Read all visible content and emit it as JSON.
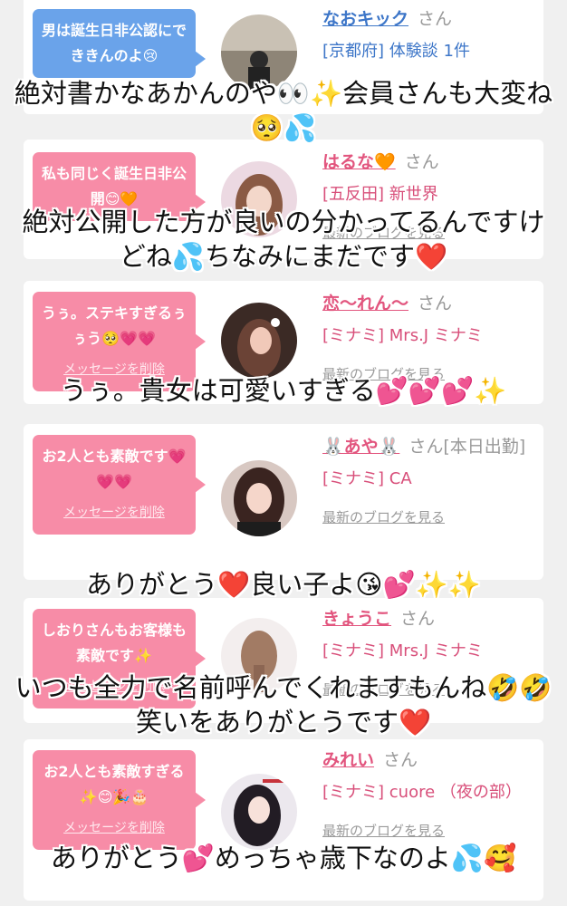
{
  "cards": [
    {
      "message": "男は誕生日非公認にでききんのよ😢",
      "bubble_color": "#6aa3ea",
      "name": "なおキック",
      "suffix": "さん",
      "shop": "[京都府] 体験談 1件",
      "theme": "blue",
      "caption": "絶対書かなあかんのや👀✨会員さんも大変ね🥺💦"
    },
    {
      "message": "私も同じく誕生日非公開😊🧡",
      "bubble_color": "#f78ca7",
      "name": "はるな🧡",
      "suffix": "さん",
      "shop": "[五反田] 新世界",
      "blog": "最新のブログを見る",
      "caption": "絶対公開した方が良いの分かってるんですけどね💦ちなみにまだです❤️"
    },
    {
      "message": "うぅ。ステキすぎるぅぅう🥺💗💗",
      "delete_label": "メッセージを削除",
      "name": "恋～れん～",
      "suffix": "さん",
      "shop": "[ミナミ] Mrs.J ミナミ",
      "blog": "最新のブログを見る",
      "caption": "うぅ。貴女は可愛いすぎる💕💕💕✨"
    },
    {
      "message": "お2人とも素敵です💗💗💗",
      "delete_label": "メッセージを削除",
      "name": "🐰あや🐰",
      "suffix": "さん[本日出勤]",
      "shop": "[ミナミ] CA",
      "blog": "最新のブログを見る",
      "caption": "ありがとう❤️良い子よ😘💕✨✨"
    },
    {
      "message": "しおりさんもお客様も素敵です✨",
      "delete_label": "メッセージを削除",
      "name": "きょうこ",
      "suffix": "さん",
      "shop": "[ミナミ] Mrs.J ミナミ",
      "blog": "最新のブログを見る",
      "caption": "いつも全力で名前呼んでくれますもんね🤣🤣笑いをありがとうです❤️"
    },
    {
      "message": "お2人とも素敵すぎる✨😊🎉🎂",
      "delete_label": "メッセージを削除",
      "name": "みれい",
      "suffix": "さん",
      "shop": "[ミナミ] cuore （夜の部）",
      "blog": "最新のブログを見る",
      "caption": "ありがとう💕めっちゃ歳下なのよ💦🥰"
    }
  ]
}
